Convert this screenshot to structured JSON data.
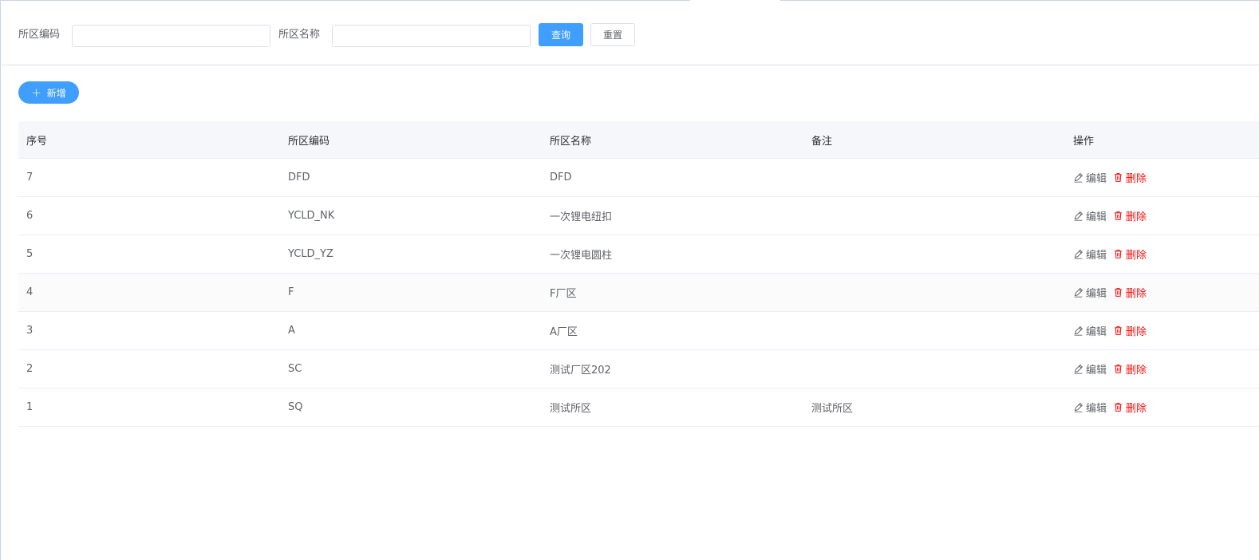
{
  "search": {
    "code_label": "所区编码",
    "code_value": "",
    "name_label": "所区名称",
    "name_value": "",
    "query_button": "查询",
    "reset_button": "重置"
  },
  "toolbar": {
    "add_button": "新增",
    "add_icon": "plus-icon"
  },
  "table": {
    "columns": [
      "序号",
      "所区编码",
      "所区名称",
      "备注",
      "操作"
    ],
    "edit_label": "编辑",
    "delete_label": "删除",
    "edit_icon": "edit-icon",
    "delete_icon": "trash-icon",
    "rows": [
      {
        "index": "7",
        "code": "DFD",
        "name": "DFD",
        "remark": ""
      },
      {
        "index": "6",
        "code": "YCLD_NK",
        "name": "一次锂电纽扣",
        "remark": ""
      },
      {
        "index": "5",
        "code": "YCLD_YZ",
        "name": "一次锂电圆柱",
        "remark": ""
      },
      {
        "index": "4",
        "code": "F",
        "name": "F厂区",
        "remark": ""
      },
      {
        "index": "3",
        "code": "A",
        "name": "A厂区",
        "remark": ""
      },
      {
        "index": "2",
        "code": "SC",
        "name": "测试厂区202",
        "remark": ""
      },
      {
        "index": "1",
        "code": "SQ",
        "name": "测试所区",
        "remark": "测试所区"
      }
    ]
  },
  "colors": {
    "primary": "#409eff",
    "danger": "#f50d0d",
    "header_bg": "#f5f7fa",
    "border": "#ebeef5"
  }
}
